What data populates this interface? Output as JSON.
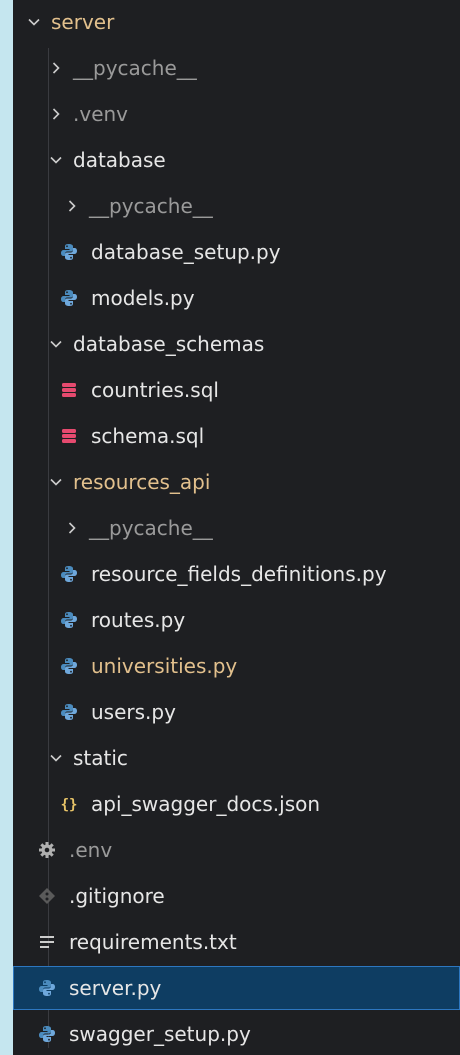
{
  "colors": {
    "panel_bg": "#1e1f22",
    "outer_bg": "#c5e6ef",
    "selection_bg": "#0e3d62",
    "modified_text": "#e2c08d",
    "python_icon": "#4b8bbe",
    "sql_icon": "#e64a6f",
    "json_icon": "#e8c468"
  },
  "tree": {
    "root": {
      "label": "server"
    },
    "items": [
      {
        "label": "__pycache__"
      },
      {
        "label": ".venv"
      },
      {
        "label": "database"
      },
      {
        "label": "__pycache__"
      },
      {
        "label": "database_setup.py"
      },
      {
        "label": "models.py"
      },
      {
        "label": "database_schemas"
      },
      {
        "label": "countries.sql"
      },
      {
        "label": "schema.sql"
      },
      {
        "label": "resources_api"
      },
      {
        "label": "__pycache__"
      },
      {
        "label": "resource_fields_definitions.py"
      },
      {
        "label": "routes.py"
      },
      {
        "label": "universities.py"
      },
      {
        "label": "users.py"
      },
      {
        "label": "static"
      },
      {
        "label": "api_swagger_docs.json"
      },
      {
        "label": ".env"
      },
      {
        "label": ".gitignore"
      },
      {
        "label": "requirements.txt"
      },
      {
        "label": "server.py",
        "selected": true
      },
      {
        "label": "swagger_setup.py"
      }
    ]
  },
  "icons": {
    "chevron_down": "chevron-down-icon",
    "chevron_right": "chevron-right-icon",
    "python": "python-file-icon",
    "sql": "database-file-icon",
    "json": "json-file-icon",
    "env": "gear-icon",
    "git": "git-icon",
    "text": "text-file-icon"
  }
}
